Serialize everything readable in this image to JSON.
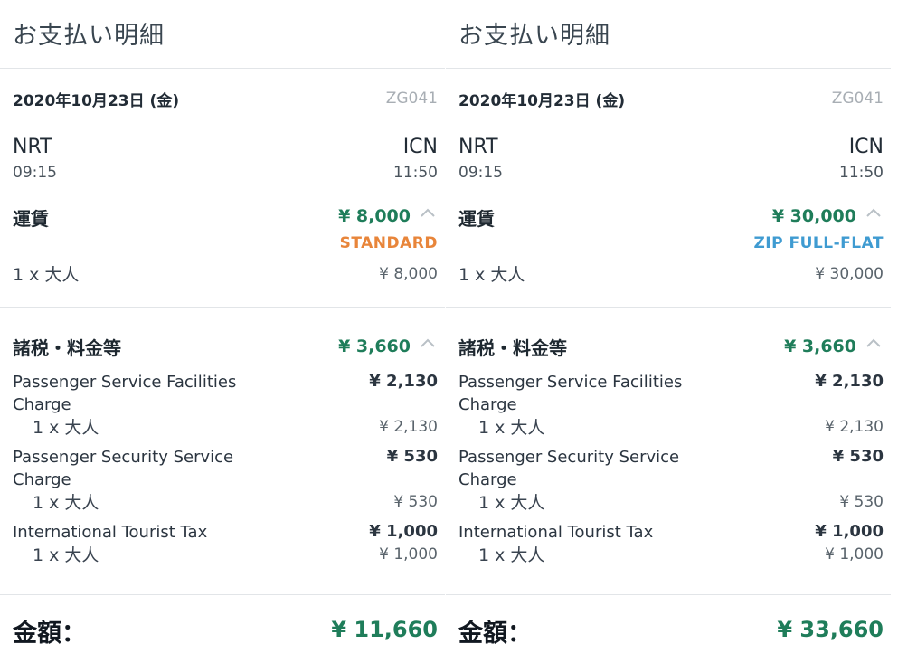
{
  "panels": [
    {
      "title": "お支払い明細",
      "date": "2020年10月23日 (金)",
      "flight_no": "ZG041",
      "origin": {
        "code": "NRT",
        "time": "09:15"
      },
      "destination": {
        "code": "ICN",
        "time": "11:50"
      },
      "fare": {
        "label": "運賃",
        "amount": "¥ 8,000",
        "type": "STANDARD",
        "type_color": "#e8853a",
        "pax": "1 x 大人",
        "pax_amount": "¥ 8,000"
      },
      "taxes": {
        "label": "諸税・料金等",
        "amount": "¥ 3,660",
        "items": [
          {
            "name": "Passenger Service Facilities Charge",
            "amount": "¥ 2,130",
            "pax": "1 x 大人",
            "pax_amount": "¥ 2,130"
          },
          {
            "name": "Passenger Security Service Charge",
            "amount": "¥ 530",
            "pax": "1 x 大人",
            "pax_amount": "¥ 530"
          },
          {
            "name": "International Tourist Tax",
            "amount": "¥ 1,000",
            "pax": "1 x 大人",
            "pax_amount": "¥ 1,000"
          }
        ]
      },
      "total": {
        "label": "金額：",
        "amount": "¥ 11,660"
      }
    },
    {
      "title": "お支払い明細",
      "date": "2020年10月23日 (金)",
      "flight_no": "ZG041",
      "origin": {
        "code": "NRT",
        "time": "09:15"
      },
      "destination": {
        "code": "ICN",
        "time": "11:50"
      },
      "fare": {
        "label": "運賃",
        "amount": "¥ 30,000",
        "type": "ZIP FULL-FLAT",
        "type_color": "#3f9bd1",
        "pax": "1 x 大人",
        "pax_amount": "¥ 30,000"
      },
      "taxes": {
        "label": "諸税・料金等",
        "amount": "¥ 3,660",
        "items": [
          {
            "name": "Passenger Service Facilities Charge",
            "amount": "¥ 2,130",
            "pax": "1 x 大人",
            "pax_amount": "¥ 2,130"
          },
          {
            "name": "Passenger Security Service Charge",
            "amount": "¥ 530",
            "pax": "1 x 大人",
            "pax_amount": "¥ 530"
          },
          {
            "name": "International Tourist Tax",
            "amount": "¥ 1,000",
            "pax": "1 x 大人",
            "pax_amount": "¥ 1,000"
          }
        ]
      },
      "total": {
        "label": "金額：",
        "amount": "¥ 33,660"
      }
    }
  ],
  "colors": {
    "accent_green": "#1f7d5a",
    "divider": "#e2e5e8"
  },
  "icons": {
    "collapse": "chevron-up-icon"
  }
}
